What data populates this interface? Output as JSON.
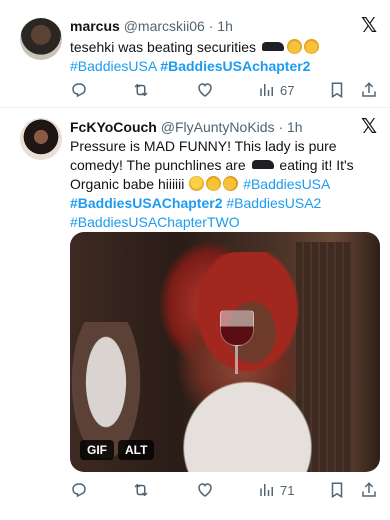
{
  "tweets": [
    {
      "display_name": "marcus",
      "handle": "@marcskii06",
      "separator": "·",
      "time": "1h",
      "text": "tesehki was beating securities",
      "emoji": [
        "car-censor",
        "loudly-crying-face",
        "loudly-crying-face"
      ],
      "hashtags": [
        "#BaddiesUSA",
        "#BaddiesUSAchapter2"
      ],
      "views": "67"
    },
    {
      "display_name": "FcKYoCouch",
      "handle": "@FlyAuntyNoKids",
      "separator": "·",
      "time": "1h",
      "text_part1": "Pressure is MAD FUNNY! This lady is pure comedy! The punchlines are",
      "text_part2": "eating it! It's Organic babe hiiiiii",
      "emoji": [
        "car-censor",
        "upside-down-face",
        "loudly-crying-face",
        "rolling-on-floor-laughing"
      ],
      "hashtags": [
        "#BaddiesUSA",
        "#BaddiesUSAChapter2",
        "#BaddiesUSA2",
        "#BaddiesUSAChapterTWO"
      ],
      "media": {
        "gif_label": "GIF",
        "alt_label": "ALT"
      },
      "views": "71"
    }
  ],
  "icons": {
    "close": "x-logo-icon",
    "reply": "reply-icon",
    "repost": "repost-icon",
    "like": "heart-icon",
    "views": "views-icon",
    "bookmark": "bookmark-icon",
    "share": "share-icon"
  },
  "colors": {
    "text": "#0f1419",
    "muted": "#536471",
    "hashtag": "#1d9bf0",
    "divider": "#eff3f4"
  }
}
